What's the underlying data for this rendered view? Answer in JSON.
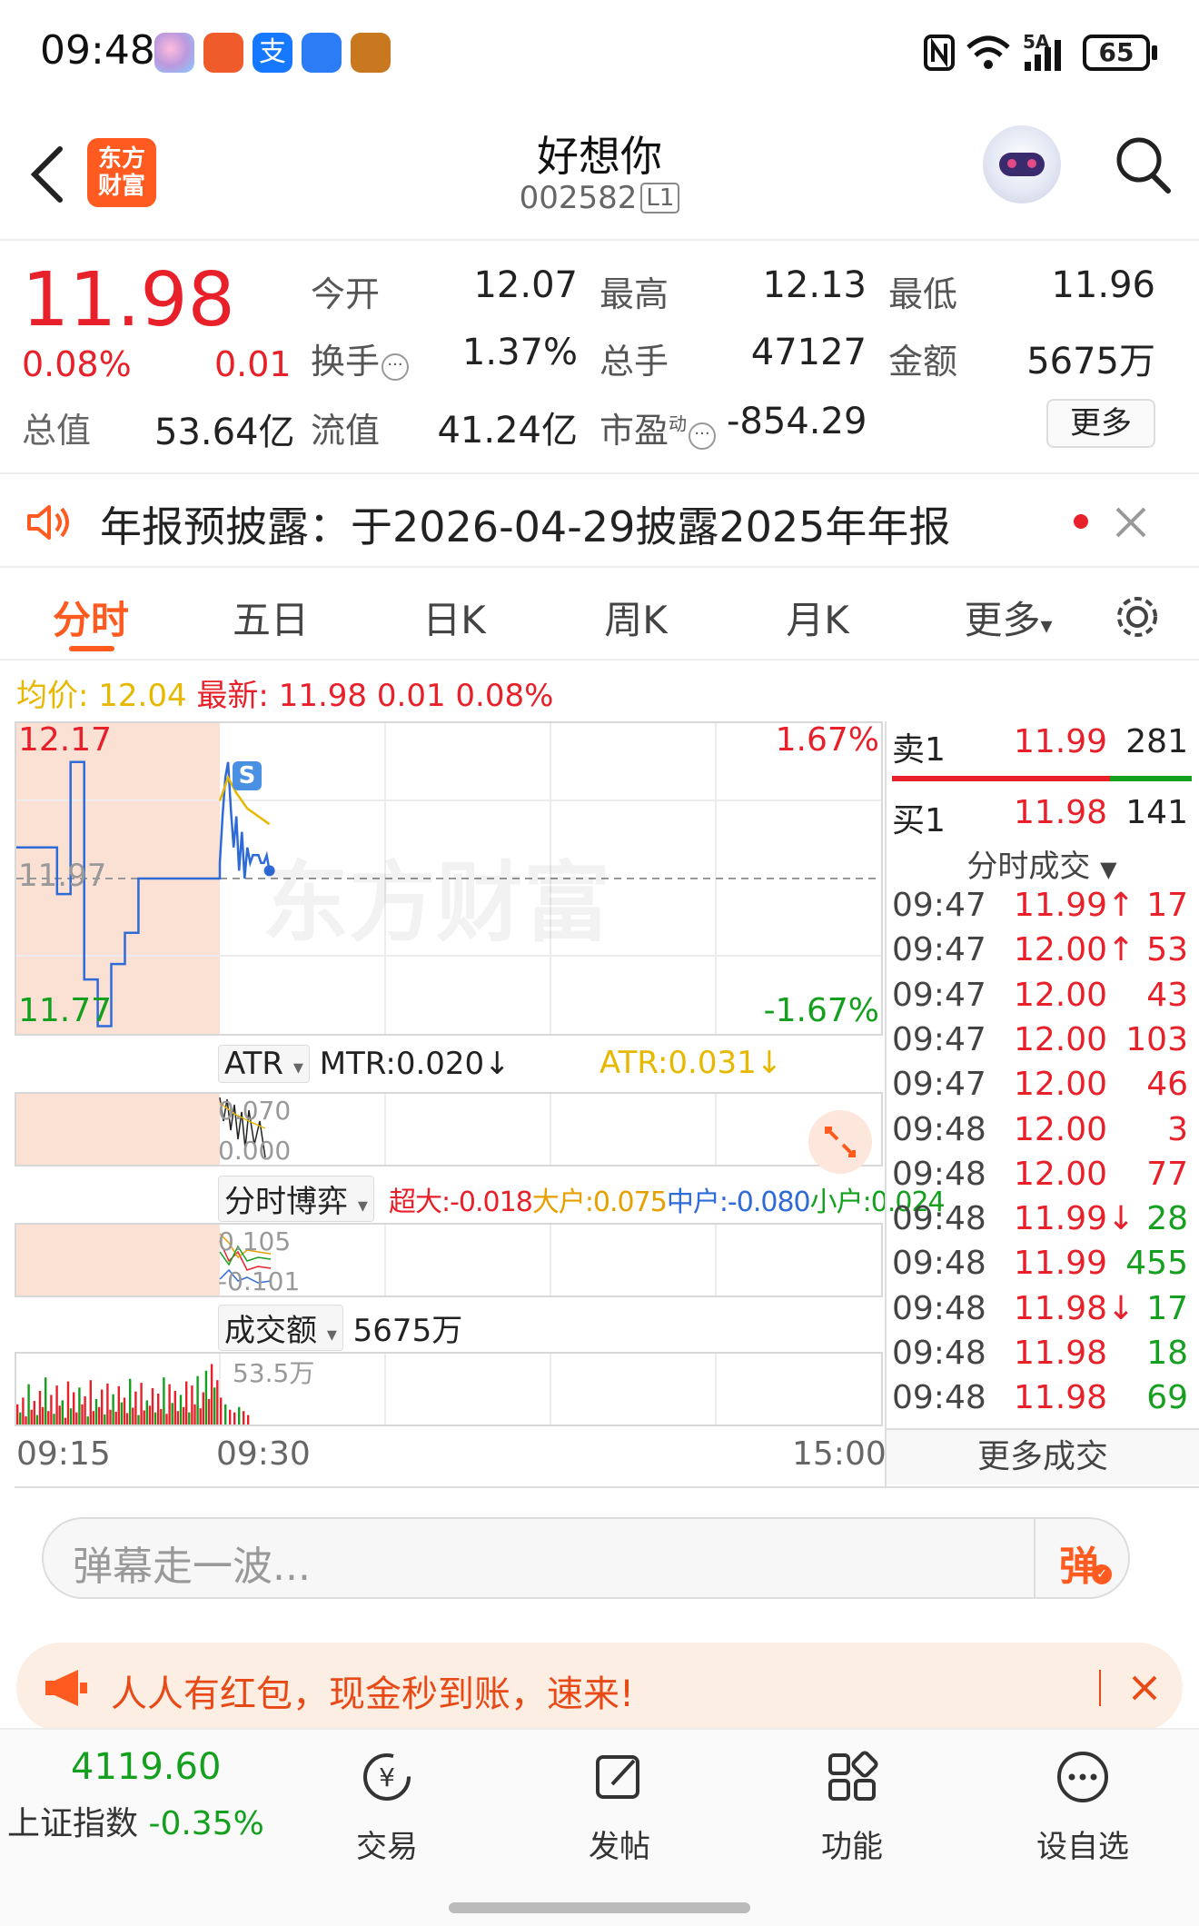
{
  "status_bar": {
    "time": "09:48",
    "network": "5A",
    "battery": "65"
  },
  "header": {
    "stock_name": "好想你",
    "stock_code": "002582",
    "level_badge": "L1",
    "app_logo_line1": "东方",
    "app_logo_line2": "财富"
  },
  "quote": {
    "price": "11.98",
    "change_pct": "0.08%",
    "change": "0.01",
    "open_label": "今开",
    "open": "12.07",
    "high_label": "最高",
    "high": "12.13",
    "low_label": "最低",
    "low": "11.96",
    "turnover_label": "换手",
    "turnover": "1.37%",
    "volume_label": "总手",
    "volume": "47127",
    "amount_label": "金额",
    "amount": "5675万",
    "mktcap_label": "总值",
    "mktcap": "53.64亿",
    "float_label": "流值",
    "float_cap": "41.24亿",
    "pe_label": "市盈",
    "pe_sup": "动",
    "pe": "-854.29",
    "more_button": "更多"
  },
  "notice": {
    "text": "年报预披露：于2026-04-29披露2025年年报"
  },
  "tabs": [
    "分时",
    "五日",
    "日K",
    "周K",
    "月K",
    "更多"
  ],
  "active_tab": 0,
  "chart_info": {
    "avg_label": "均价:",
    "avg_value": "12.04",
    "latest_label": "最新:",
    "latest_value": "11.98",
    "latest_change": "0.01",
    "latest_pct": "0.08%",
    "y_top": "12.17",
    "y_mid": "11.97",
    "y_bottom": "11.77",
    "pct_top": "1.67%",
    "pct_bottom": "-1.67%",
    "watermark": "东方财富",
    "s_marker": "S",
    "time_start": "09:15",
    "time_mid": "09:30",
    "time_end": "15:00"
  },
  "indicators": {
    "atr_select": "ATR",
    "mtr_text": "MTR:0.020↓",
    "atr_text": "ATR:0.031↓",
    "atr_top": "0.070",
    "atr_bottom": "0.000",
    "boyi_select": "分时博弈",
    "boyi_super": "超大:-0.018",
    "boyi_big": "大户:0.075",
    "boyi_mid": "中户:-0.080",
    "boyi_small": "小户:0.024",
    "boyi_top": "0.105",
    "boyi_bottom": "-0.101",
    "vol_select": "成交额",
    "vol_value": "5675万",
    "vol_max": "53.5万"
  },
  "colors": {
    "red": "#e8202a",
    "green": "#14a01e",
    "accent": "#ff5a1f",
    "avg_line": "#e6b800",
    "price_line": "#2f6bd8"
  },
  "order_book": {
    "sell1": {
      "label": "卖1",
      "price": "11.99",
      "vol": "281"
    },
    "buy1": {
      "label": "买1",
      "price": "11.98",
      "vol": "141"
    },
    "trades_title": "分时成交",
    "trades": [
      {
        "time": "09:47",
        "price": "11.99↑",
        "vol": "17",
        "color": "red"
      },
      {
        "time": "09:47",
        "price": "12.00↑",
        "vol": "53",
        "color": "red"
      },
      {
        "time": "09:47",
        "price": "12.00",
        "vol": "43",
        "color": "red"
      },
      {
        "time": "09:47",
        "price": "12.00",
        "vol": "103",
        "color": "red"
      },
      {
        "time": "09:47",
        "price": "12.00",
        "vol": "46",
        "color": "red"
      },
      {
        "time": "09:48",
        "price": "12.00",
        "vol": "3",
        "color": "red"
      },
      {
        "time": "09:48",
        "price": "12.00",
        "vol": "77",
        "color": "red"
      },
      {
        "time": "09:48",
        "price": "11.99↓",
        "vol": "28",
        "color": "green"
      },
      {
        "time": "09:48",
        "price": "11.99",
        "vol": "455",
        "color": "green"
      },
      {
        "time": "09:48",
        "price": "11.98↓",
        "vol": "17",
        "color": "green"
      },
      {
        "time": "09:48",
        "price": "11.98",
        "vol": "18",
        "color": "green"
      },
      {
        "time": "09:48",
        "price": "11.98",
        "vol": "69",
        "color": "green"
      }
    ],
    "more_trades": "更多成交"
  },
  "danmu": {
    "placeholder": "弹幕走一波...",
    "button": "弹"
  },
  "promo": {
    "text": "人人有红包，现金秒到账，速来!"
  },
  "bottom_bar": {
    "index_value": "4119.60",
    "index_name": "上证指数",
    "index_change": "-0.35%",
    "items": [
      "交易",
      "发帖",
      "功能",
      "设自选"
    ]
  },
  "chart_data": {
    "type": "line",
    "x_range": [
      "09:15",
      "15:00"
    ],
    "ylim": [
      11.77,
      12.17
    ],
    "pct_range": [
      "-1.67%",
      "1.67%"
    ],
    "reference_price": 11.97,
    "series": [
      {
        "name": "最新",
        "points": [
          [
            "09:15",
            12.01
          ],
          [
            "09:17",
            12.01
          ],
          [
            "09:18",
            11.95
          ],
          [
            "09:19",
            12.12
          ],
          [
            "09:20",
            11.84
          ],
          [
            "09:21",
            11.78
          ],
          [
            "09:22",
            11.86
          ],
          [
            "09:23",
            11.9
          ],
          [
            "09:24",
            11.97
          ],
          [
            "09:25",
            11.97
          ],
          [
            "09:29",
            11.97
          ],
          [
            "09:30",
            11.99
          ],
          [
            "09:31",
            12.05
          ],
          [
            "09:32",
            12.1
          ],
          [
            "09:33",
            12.12
          ],
          [
            "09:34",
            12.06
          ],
          [
            "09:35",
            12.01
          ],
          [
            "09:36",
            12.05
          ],
          [
            "09:37",
            11.98
          ],
          [
            "09:38",
            12.03
          ],
          [
            "09:39",
            11.97
          ],
          [
            "09:40",
            12.01
          ],
          [
            "09:41",
            11.99
          ],
          [
            "09:42",
            12.0
          ],
          [
            "09:43",
            12.0
          ],
          [
            "09:44",
            12.0
          ],
          [
            "09:45",
            11.99
          ],
          [
            "09:46",
            11.99
          ],
          [
            "09:47",
            12.0
          ],
          [
            "09:48",
            11.98
          ]
        ]
      },
      {
        "name": "均价",
        "points": [
          [
            "09:30",
            12.07
          ],
          [
            "09:33",
            12.1
          ],
          [
            "09:36",
            12.08
          ],
          [
            "09:40",
            12.06
          ],
          [
            "09:44",
            12.05
          ],
          [
            "09:48",
            12.04
          ]
        ]
      }
    ]
  }
}
